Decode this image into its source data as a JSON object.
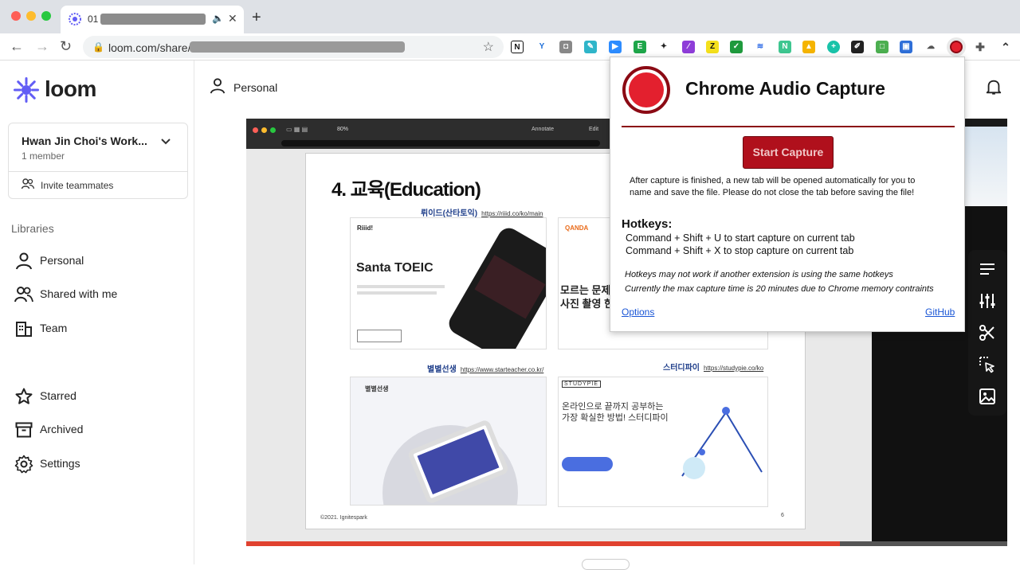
{
  "browser": {
    "tab_title_prefix": "01",
    "new_tab": "+",
    "url_prefix": "loom.com/share/",
    "star_icon": "star-icon"
  },
  "sidebar": {
    "logo": "loom",
    "workspace": {
      "name": "Hwan Jin Choi's Work...",
      "members": "1 member",
      "invite": "Invite teammates"
    },
    "libraries_header": "Libraries",
    "items": [
      {
        "label": "Personal",
        "icon": "person-icon"
      },
      {
        "label": "Shared with me",
        "icon": "people-icon"
      },
      {
        "label": "Team",
        "icon": "building-icon"
      },
      {
        "label": "Starred",
        "icon": "star-icon"
      },
      {
        "label": "Archived",
        "icon": "archive-icon"
      },
      {
        "label": "Settings",
        "icon": "gear-icon"
      }
    ]
  },
  "main": {
    "header": "Personal"
  },
  "slide": {
    "pdf_zoom": "80%",
    "annotate": "Annotate",
    "edit": "Edit",
    "title": "4. 교육(Education)",
    "cards": [
      {
        "caption": "뤼이드(산타토익)",
        "url": "https://riiid.co/ko/main",
        "brand": "Riiid!",
        "headline": "Santa TOEIC"
      },
      {
        "caption": "",
        "url": "",
        "brand": "QANDA",
        "headline": "모르는 문제\n사진 촬영 한"
      },
      {
        "caption": "별별선생",
        "url": "https://www.starteacher.co.kr/",
        "brand": "별별선생",
        "headline": ""
      },
      {
        "caption": "스터디파이",
        "url": "https://studypie.co/ko",
        "brand": "STUDYPIE",
        "headline": "온라인으로 끝까지 공부하는\n가장 확실한 방법! 스터디파이"
      }
    ],
    "footer": "©2021. Ignitespark",
    "page": "6"
  },
  "popup": {
    "title": "Chrome Audio Capture",
    "start_button": "Start Capture",
    "info": "After capture is finished, a new tab will be opened automatically for you to name and save the file. Please do not close the tab before saving the file!",
    "hotkeys_header": "Hotkeys:",
    "hotkeys": [
      "Command + Shift + U to start capture on current tab",
      "Command + Shift + X to stop capture on current tab"
    ],
    "notes": [
      "Hotkeys may not work if another extension is using the same hotkeys",
      "Currently the max capture time is 20 minutes due to Chrome memory contraints"
    ],
    "options_link": "Options",
    "github_link": "GitHub"
  },
  "video": {
    "progress": 0.78
  },
  "colors": {
    "loom_purple": "#625df5",
    "popup_red": "#b0101c",
    "progress": "#e0412f"
  }
}
